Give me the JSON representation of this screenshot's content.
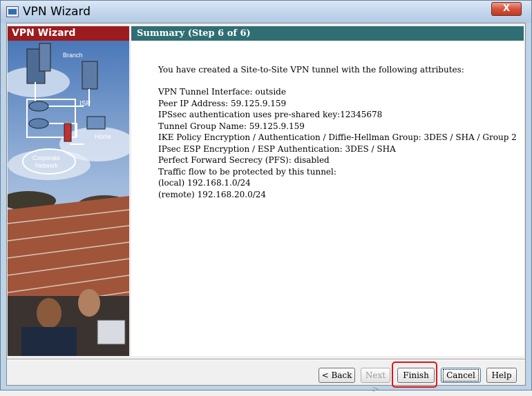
{
  "window": {
    "title": "VPN Wizard",
    "close_label": "X"
  },
  "left_panel": {
    "header": "VPN Wizard",
    "art_labels": {
      "branch": "Branch",
      "isp": "ISP",
      "home": "Home",
      "corporate": "Corporate",
      "network": "Network"
    }
  },
  "step": {
    "title": "Summary  (Step 6 of 6)"
  },
  "summary": {
    "intro": "You have created a Site-to-Site VPN tunnel with the following attributes:",
    "lines": [
      "VPN Tunnel Interface: outside",
      "Peer IP Address: 59.125.9.159",
      "IPSsec authentication uses pre-shared key:12345678",
      "Tunnel Group Name: 59.125.9.159",
      "IKE Policy Encryption / Authentication / Diffie-Hellman Group: 3DES / SHA / Group 2",
      "IPsec ESP Encryption / ESP Authentication: 3DES / SHA",
      "Perfect Forward Secrecy (PFS): disabled",
      "Traffic flow to be protected by this tunnel:",
      "(local) 192.168.1.0/24",
      "(remote) 192.168.20.0/24"
    ]
  },
  "buttons": {
    "back": "< Back",
    "next": "Next >",
    "finish": "Finish",
    "cancel": "Cancel",
    "help": "Help"
  },
  "colors": {
    "left_header": "#9b1b1e",
    "right_header": "#2f6f73",
    "highlight": "#e0141b"
  }
}
